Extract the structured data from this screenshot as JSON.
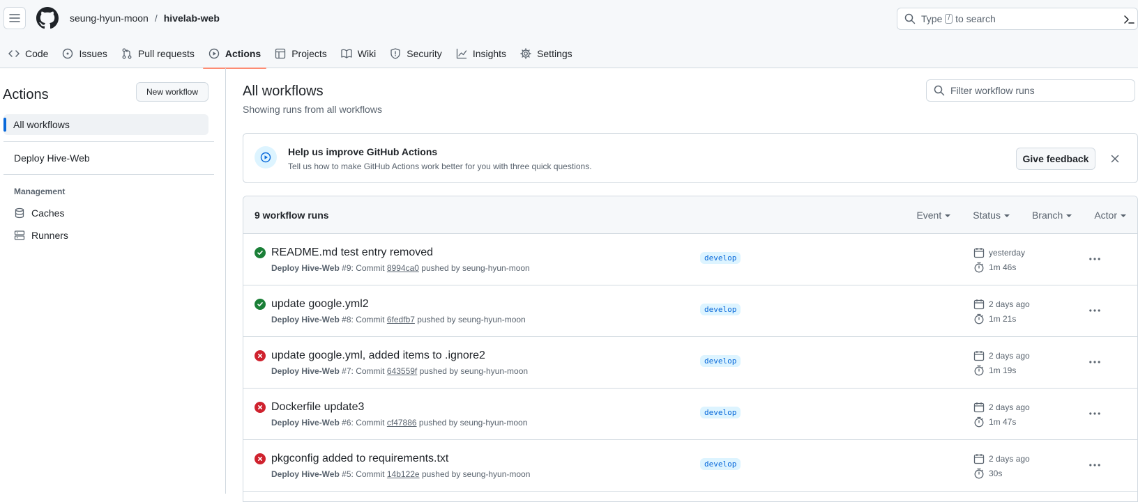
{
  "header": {
    "owner": "seung-hyun-moon",
    "separator": "/",
    "repo": "hivelab-web",
    "search_prefix": "Type",
    "search_key": "/",
    "search_suffix": "to search"
  },
  "tabs": [
    {
      "label": "Code",
      "icon": "code-icon"
    },
    {
      "label": "Issues",
      "icon": "issue-icon"
    },
    {
      "label": "Pull requests",
      "icon": "pull-request-icon"
    },
    {
      "label": "Actions",
      "icon": "play-icon",
      "active": true
    },
    {
      "label": "Projects",
      "icon": "table-icon"
    },
    {
      "label": "Wiki",
      "icon": "book-icon"
    },
    {
      "label": "Security",
      "icon": "shield-icon"
    },
    {
      "label": "Insights",
      "icon": "graph-icon"
    },
    {
      "label": "Settings",
      "icon": "gear-icon"
    }
  ],
  "sidebar": {
    "title": "Actions",
    "new_workflow": "New workflow",
    "all_workflows": "All workflows",
    "workflow": "Deploy Hive-Web",
    "management_label": "Management",
    "caches": "Caches",
    "runners": "Runners"
  },
  "main": {
    "title": "All workflows",
    "subtitle": "Showing runs from all workflows",
    "filter_placeholder": "Filter workflow runs"
  },
  "feedback": {
    "title": "Help us improve GitHub Actions",
    "text": "Tell us how to make GitHub Actions work better for you with three quick questions.",
    "button": "Give feedback"
  },
  "runs": {
    "count_label": "9 workflow runs",
    "filters": [
      "Event",
      "Status",
      "Branch",
      "Actor"
    ],
    "pushed_by_text": "pushed by",
    "commit_text": "Commit",
    "items": [
      {
        "status": "success",
        "title": "README.md test entry removed",
        "workflow": "Deploy Hive-Web",
        "number": "#9",
        "sha": "8994ca0",
        "actor": "seung-hyun-moon",
        "branch": "develop",
        "when": "yesterday",
        "duration": "1m 46s"
      },
      {
        "status": "success",
        "title": "update google.yml2",
        "workflow": "Deploy Hive-Web",
        "number": "#8",
        "sha": "6fedfb7",
        "actor": "seung-hyun-moon",
        "branch": "develop",
        "when": "2 days ago",
        "duration": "1m 21s"
      },
      {
        "status": "failure",
        "title": "update google.yml, added items to .ignore2",
        "workflow": "Deploy Hive-Web",
        "number": "#7",
        "sha": "643559f",
        "actor": "seung-hyun-moon",
        "branch": "develop",
        "when": "2 days ago",
        "duration": "1m 19s"
      },
      {
        "status": "failure",
        "title": "Dockerfile update3",
        "workflow": "Deploy Hive-Web",
        "number": "#6",
        "sha": "cf47886",
        "actor": "seung-hyun-moon",
        "branch": "develop",
        "when": "2 days ago",
        "duration": "1m 47s"
      },
      {
        "status": "failure",
        "title": "pkgconfig added to requirements.txt",
        "workflow": "Deploy Hive-Web",
        "number": "#5",
        "sha": "14b122e",
        "actor": "seung-hyun-moon",
        "branch": "develop",
        "when": "2 days ago",
        "duration": "30s"
      }
    ]
  },
  "colors": {
    "accent_blue": "#0969da",
    "success_green": "#1a7f37",
    "failure_red": "#cf222e",
    "tab_underline": "#fd8c73"
  }
}
